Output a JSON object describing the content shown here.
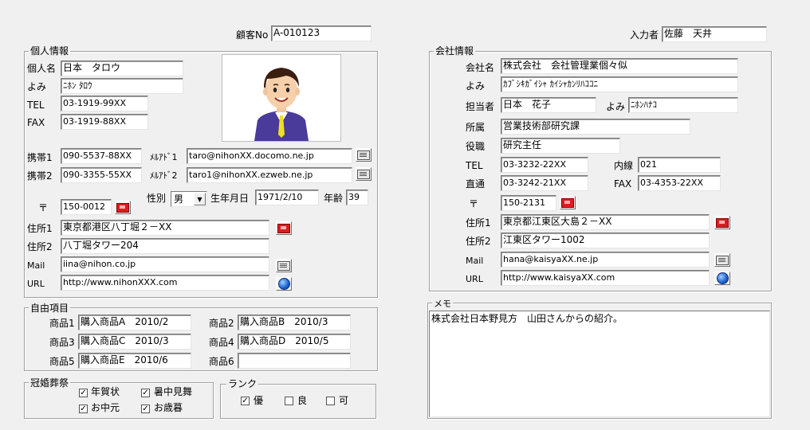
{
  "header": {
    "customer_no_label": "顧客No",
    "customer_no": "A-010123",
    "entered_by_label": "入力者",
    "entered_by": "佐藤　天井"
  },
  "personal": {
    "title": "個人情報",
    "name_label": "個人名",
    "name": "日本　タロウ",
    "kana_label": "よみ",
    "kana": "ﾆﾎﾝ ﾀﾛｳ",
    "tel_label": "TEL",
    "tel": "03-1919-99XX",
    "fax_label": "FAX",
    "fax": "03-1919-88XX",
    "mobile1_label": "携帯1",
    "mobile1": "090-5537-88XX",
    "mail1_label": "ﾒﾙｱﾄﾞ1",
    "mail1": "taro@nihonXX.docomo.ne.jp",
    "mobile2_label": "携帯2",
    "mobile2": "090-3355-55XX",
    "mail2_label": "ﾒﾙｱﾄﾞ2",
    "mail2": "taro1@nihonXX.ezweb.ne.jp",
    "zip_label": "〒",
    "zip": "150-0012",
    "gender_label": "性別",
    "gender": "男",
    "birthday_label": "生年月日",
    "birthday": "1971/2/10",
    "age_label": "年齢",
    "age": "39",
    "addr1_label": "住所1",
    "addr1": "東京都港区八丁堀２－XX",
    "addr2_label": "住所2",
    "addr2": "八丁堀タワー204",
    "email_label": "Mail",
    "email": "iina@nihon.co.jp",
    "url_label": "URL",
    "url": "http://www.nihonXXX.com"
  },
  "company": {
    "title": "会社情報",
    "name_label": "会社名",
    "name": "株式会社　会社管理業個々似",
    "kana_label": "よみ",
    "kana": "ｶﾌﾞｼｷｶﾞｲｼｬ ｶｲｼｬｶﾝﾘﾊｺｺﾆ",
    "contact_label": "担当者",
    "contact": "日本　花子",
    "contact_kana_label": "よみ",
    "contact_kana": "ﾆﾎﾝﾊﾅｺ",
    "dept_label": "所属",
    "dept": "営業技術部研究課",
    "position_label": "役職",
    "position": "研究主任",
    "tel_label": "TEL",
    "tel": "03-3232-22XX",
    "ext_label": "内線",
    "ext": "021",
    "direct_label": "直通",
    "direct": "03-3242-21XX",
    "fax_label": "FAX",
    "fax": "03-4353-22XX",
    "zip_label": "〒",
    "zip": "150-2131",
    "addr1_label": "住所1",
    "addr1": "東京都江東区大島２－XX",
    "addr2_label": "住所2",
    "addr2": "江東区タワー1002",
    "email_label": "Mail",
    "email": "hana@kaisyaXX.ne.jp",
    "url_label": "URL",
    "url": "http://www.kaisyaXX.com"
  },
  "free": {
    "title": "自由項目",
    "p1_label": "商品1",
    "p1": "購入商品A　2010/2",
    "p2_label": "商品2",
    "p2": "購入商品B　2010/3",
    "p3_label": "商品3",
    "p3": "購入商品C　2010/3",
    "p4_label": "商品4",
    "p4": "購入商品D　2010/5",
    "p5_label": "商品5",
    "p5": "購入商品E　2010/6",
    "p6_label": "商品6",
    "p6": ""
  },
  "ceremony": {
    "title": "冠婚葬祭",
    "items": [
      {
        "label": "年賀状",
        "checked": "✓"
      },
      {
        "label": "暑中見舞",
        "checked": "✓"
      },
      {
        "label": "お中元",
        "checked": "✓"
      },
      {
        "label": "お歳暮",
        "checked": "✓"
      }
    ]
  },
  "rank": {
    "title": "ランク",
    "items": [
      {
        "label": "優",
        "checked": "✓"
      },
      {
        "label": "良",
        "checked": ""
      },
      {
        "label": "可",
        "checked": ""
      }
    ]
  },
  "memo": {
    "title": "メモ",
    "text": "株式会社日本野見方　山田さんからの紹介。"
  },
  "icons": {
    "zip_button": "postal-lookup-icon",
    "mail_button": "mail-icon",
    "url_button": "globe-icon"
  }
}
